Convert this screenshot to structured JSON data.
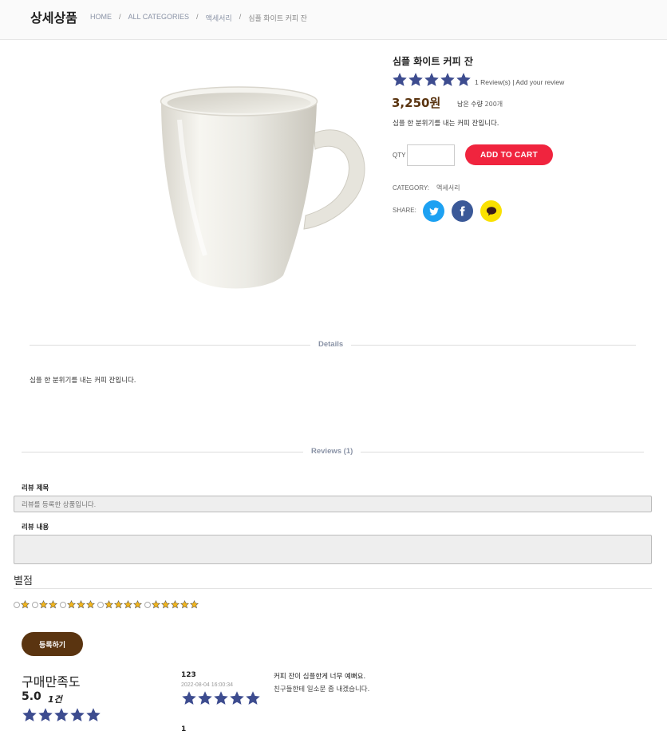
{
  "header": {
    "title": "상세상품",
    "breadcrumb": [
      "HOME",
      "ALL CATEGORIES",
      "액세서리",
      "심플 화이트 커피 잔"
    ]
  },
  "product": {
    "name": "심플 화이트 커피 잔",
    "rating": 5,
    "rating_max": 5,
    "review_link": "1 Review(s) | Add your review",
    "price": "3,250원",
    "stock_label": "남은 수량",
    "stock_value": "200개",
    "description": "심플 한 분위기를 내는 커피 잔입니다.",
    "qty_label": "QTY",
    "qty_value": "",
    "add_to_cart_label": "ADD TO CART",
    "category_label": "CATEGORY:",
    "category_value": "액세서리",
    "share_label": "SHARE:",
    "share_icons": [
      "twitter-icon",
      "facebook-icon",
      "kakaotalk-icon"
    ]
  },
  "details": {
    "heading": "Details",
    "text": "심플 한 분위기를 내는 커피 잔입니다."
  },
  "reviews": {
    "heading": "Reviews (1)",
    "form": {
      "title_label": "리뷰 제목",
      "title_placeholder": "리뷰를 등록한 상품입니다.",
      "content_label": "리뷰 내용",
      "content_value": "",
      "rating_heading": "별점",
      "rating_options": [
        1,
        2,
        3,
        4,
        5
      ],
      "submit_label": "등록하기"
    },
    "summary": {
      "title": "구매만족도",
      "score": "5.0",
      "count": "1건",
      "stars": 5
    },
    "items": [
      {
        "author": "123",
        "date": "2022-08-04 16:00:34",
        "stars": 5,
        "title": "커피 잔이 심플한게 너무 예뻐요.",
        "body": "친구들한테 일소문 좀 내겠습니다."
      }
    ],
    "pagination": "1"
  },
  "colors": {
    "star": "#3d4c8f",
    "star_small": "#f2b51c",
    "cart_button": "#f0243e",
    "brown": "#5a3410",
    "twitter": "#1da1f2",
    "facebook": "#3b5998",
    "kakao": "#fae100"
  }
}
